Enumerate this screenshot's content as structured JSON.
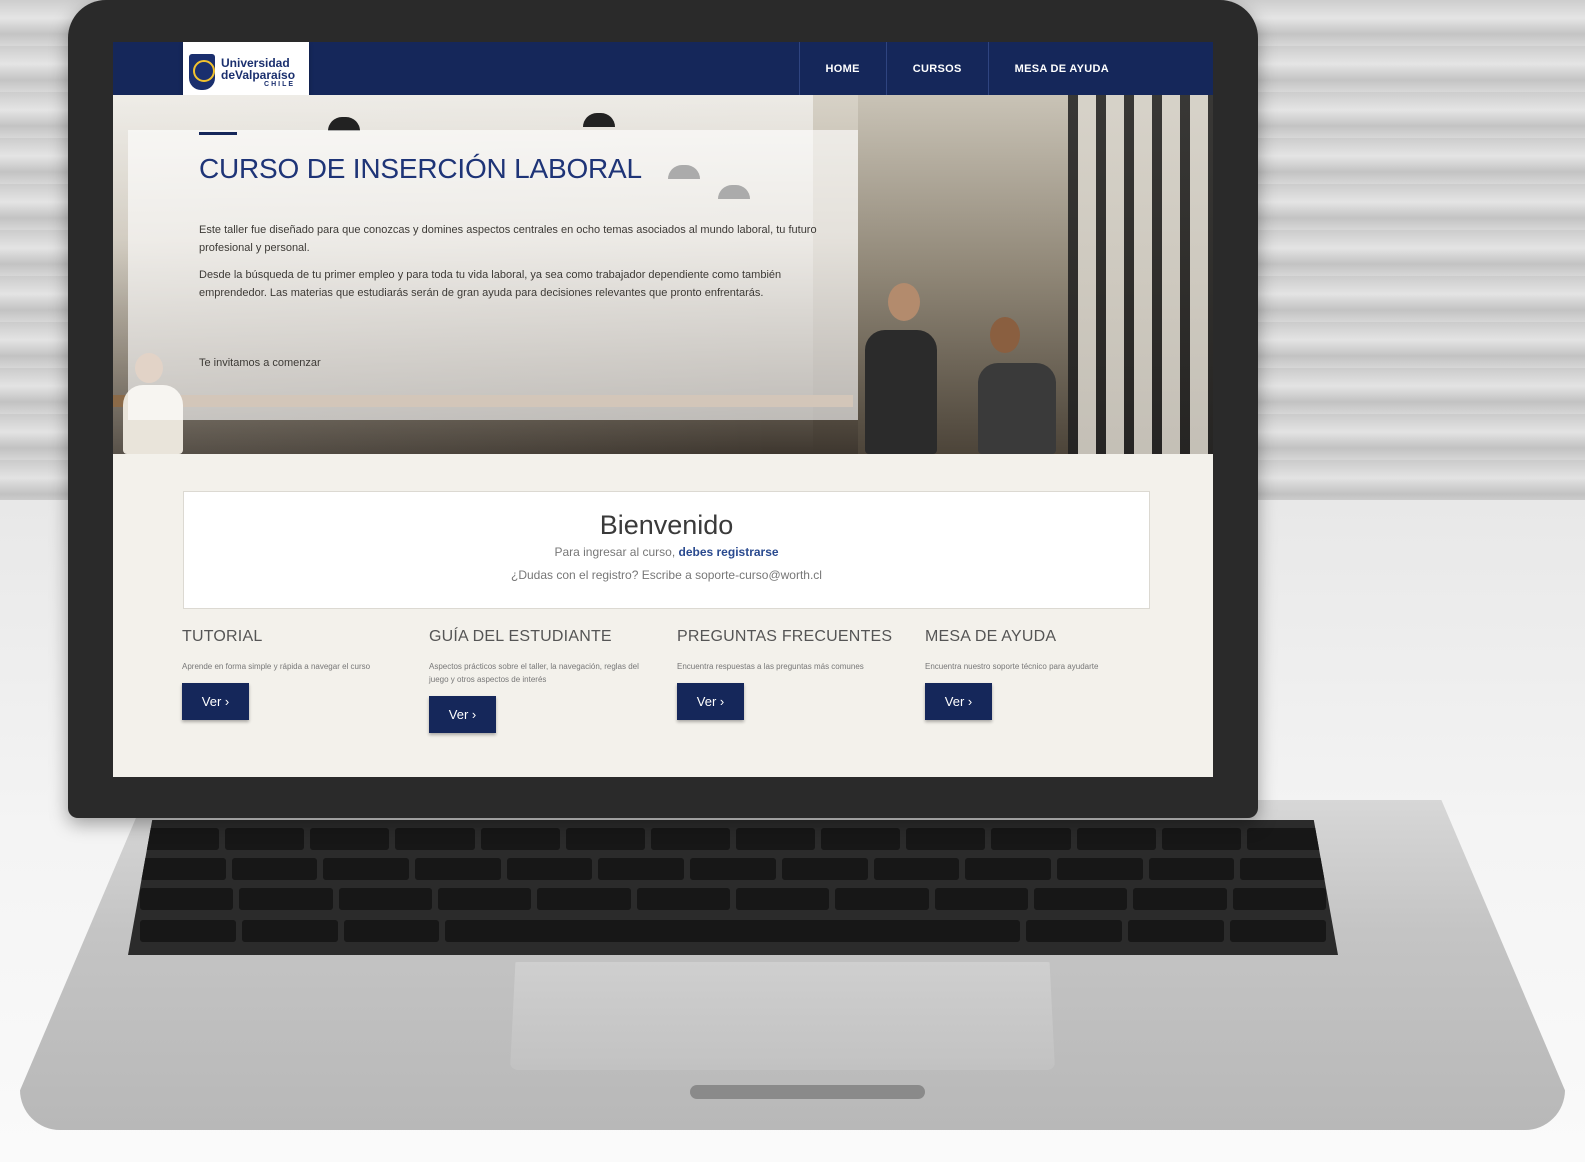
{
  "nav": {
    "logo_line1": "Universidad",
    "logo_line2": "deValparaíso",
    "logo_line3": "CHILE",
    "links": [
      {
        "label": "HOME"
      },
      {
        "label": "CURSOS"
      },
      {
        "label": "MESA DE AYUDA"
      }
    ]
  },
  "hero": {
    "title": "CURSO DE INSERCIÓN LABORAL",
    "paragraph1": "Este taller fue diseñado para que conozcas y domines aspectos centrales en ocho temas asociados al mundo laboral, tu futuro profesional y personal.",
    "paragraph2": "Desde la búsqueda de tu primer empleo y para toda tu vida laboral, ya sea como trabajador dependiente como también emprendedor. Las materias que estudiarás serán de gran ayuda para decisiones relevantes que pronto enfrentarás.",
    "cta": "Te invitamos a comenzar"
  },
  "welcome": {
    "title": "Bienvenido",
    "line1_prefix": "Para ingresar al curso, ",
    "line1_link": "debes registrarse",
    "line2": "¿Dudas con el registro? Escribe a soporte-curso@worth.cl"
  },
  "cards": [
    {
      "title": "TUTORIAL",
      "desc": "Aprende en forma simple y rápida a navegar el curso",
      "button": "Ver ›"
    },
    {
      "title": "GUÍA DEL ESTUDIANTE",
      "desc": "Aspectos prácticos sobre el taller, la navegación, reglas del juego y otros aspectos de interés",
      "button": "Ver ›"
    },
    {
      "title": "PREGUNTAS FRECUENTES",
      "desc": "Encuentra respuestas a las preguntas más comunes",
      "button": "Ver ›"
    },
    {
      "title": "MESA DE AYUDA",
      "desc": "Encuentra nuestro soporte técnico para ayudarte",
      "button": "Ver ›"
    }
  ],
  "colors": {
    "nav_bg": "#15275a",
    "title_blue": "#1e3477",
    "page_bg": "#f3f1eb"
  }
}
